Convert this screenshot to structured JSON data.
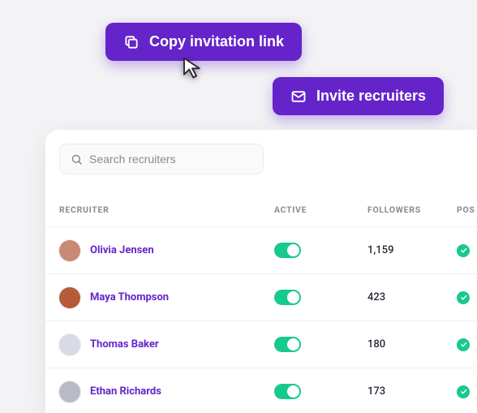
{
  "buttons": {
    "copy_label": "Copy invitation link",
    "invite_label": "Invite recruiters"
  },
  "search": {
    "placeholder": "Search recruiters"
  },
  "columns": {
    "recruiter": "RECRUITER",
    "active": "ACTIVE",
    "followers": "FOLLOWERS",
    "pos": "POS"
  },
  "rows": [
    {
      "name": "Olivia Jensen",
      "followers": "1,159",
      "avatar_bg": "#c88a74"
    },
    {
      "name": "Maya Thompson",
      "followers": "423",
      "avatar_bg": "#b55b3a"
    },
    {
      "name": "Thomas Baker",
      "followers": "180",
      "avatar_bg": "#d8dbe3"
    },
    {
      "name": "Ethan Richards",
      "followers": "173",
      "avatar_bg": "#b9bbc4"
    }
  ]
}
